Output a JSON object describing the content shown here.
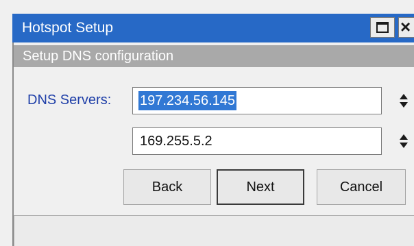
{
  "window": {
    "title": "Hotspot Setup",
    "controls": {
      "maximize_icon": "maximize-icon",
      "close_icon": "close-icon",
      "close_glyph": "×"
    }
  },
  "section": {
    "header": "Setup DNS configuration"
  },
  "dns": {
    "label": "DNS Servers:",
    "servers": [
      {
        "value": "197.234.56.145",
        "selected": true
      },
      {
        "value": "169.255.5.2",
        "selected": false
      }
    ],
    "spinner_icon": "spinner-updown-icon"
  },
  "buttons": {
    "back": "Back",
    "next": "Next",
    "cancel": "Cancel"
  },
  "status": {
    "text": ""
  },
  "colors": {
    "titlebar": "#2769c6",
    "section_header": "#a9a9a9",
    "label": "#1f3fa8",
    "selection": "#3178d4"
  }
}
